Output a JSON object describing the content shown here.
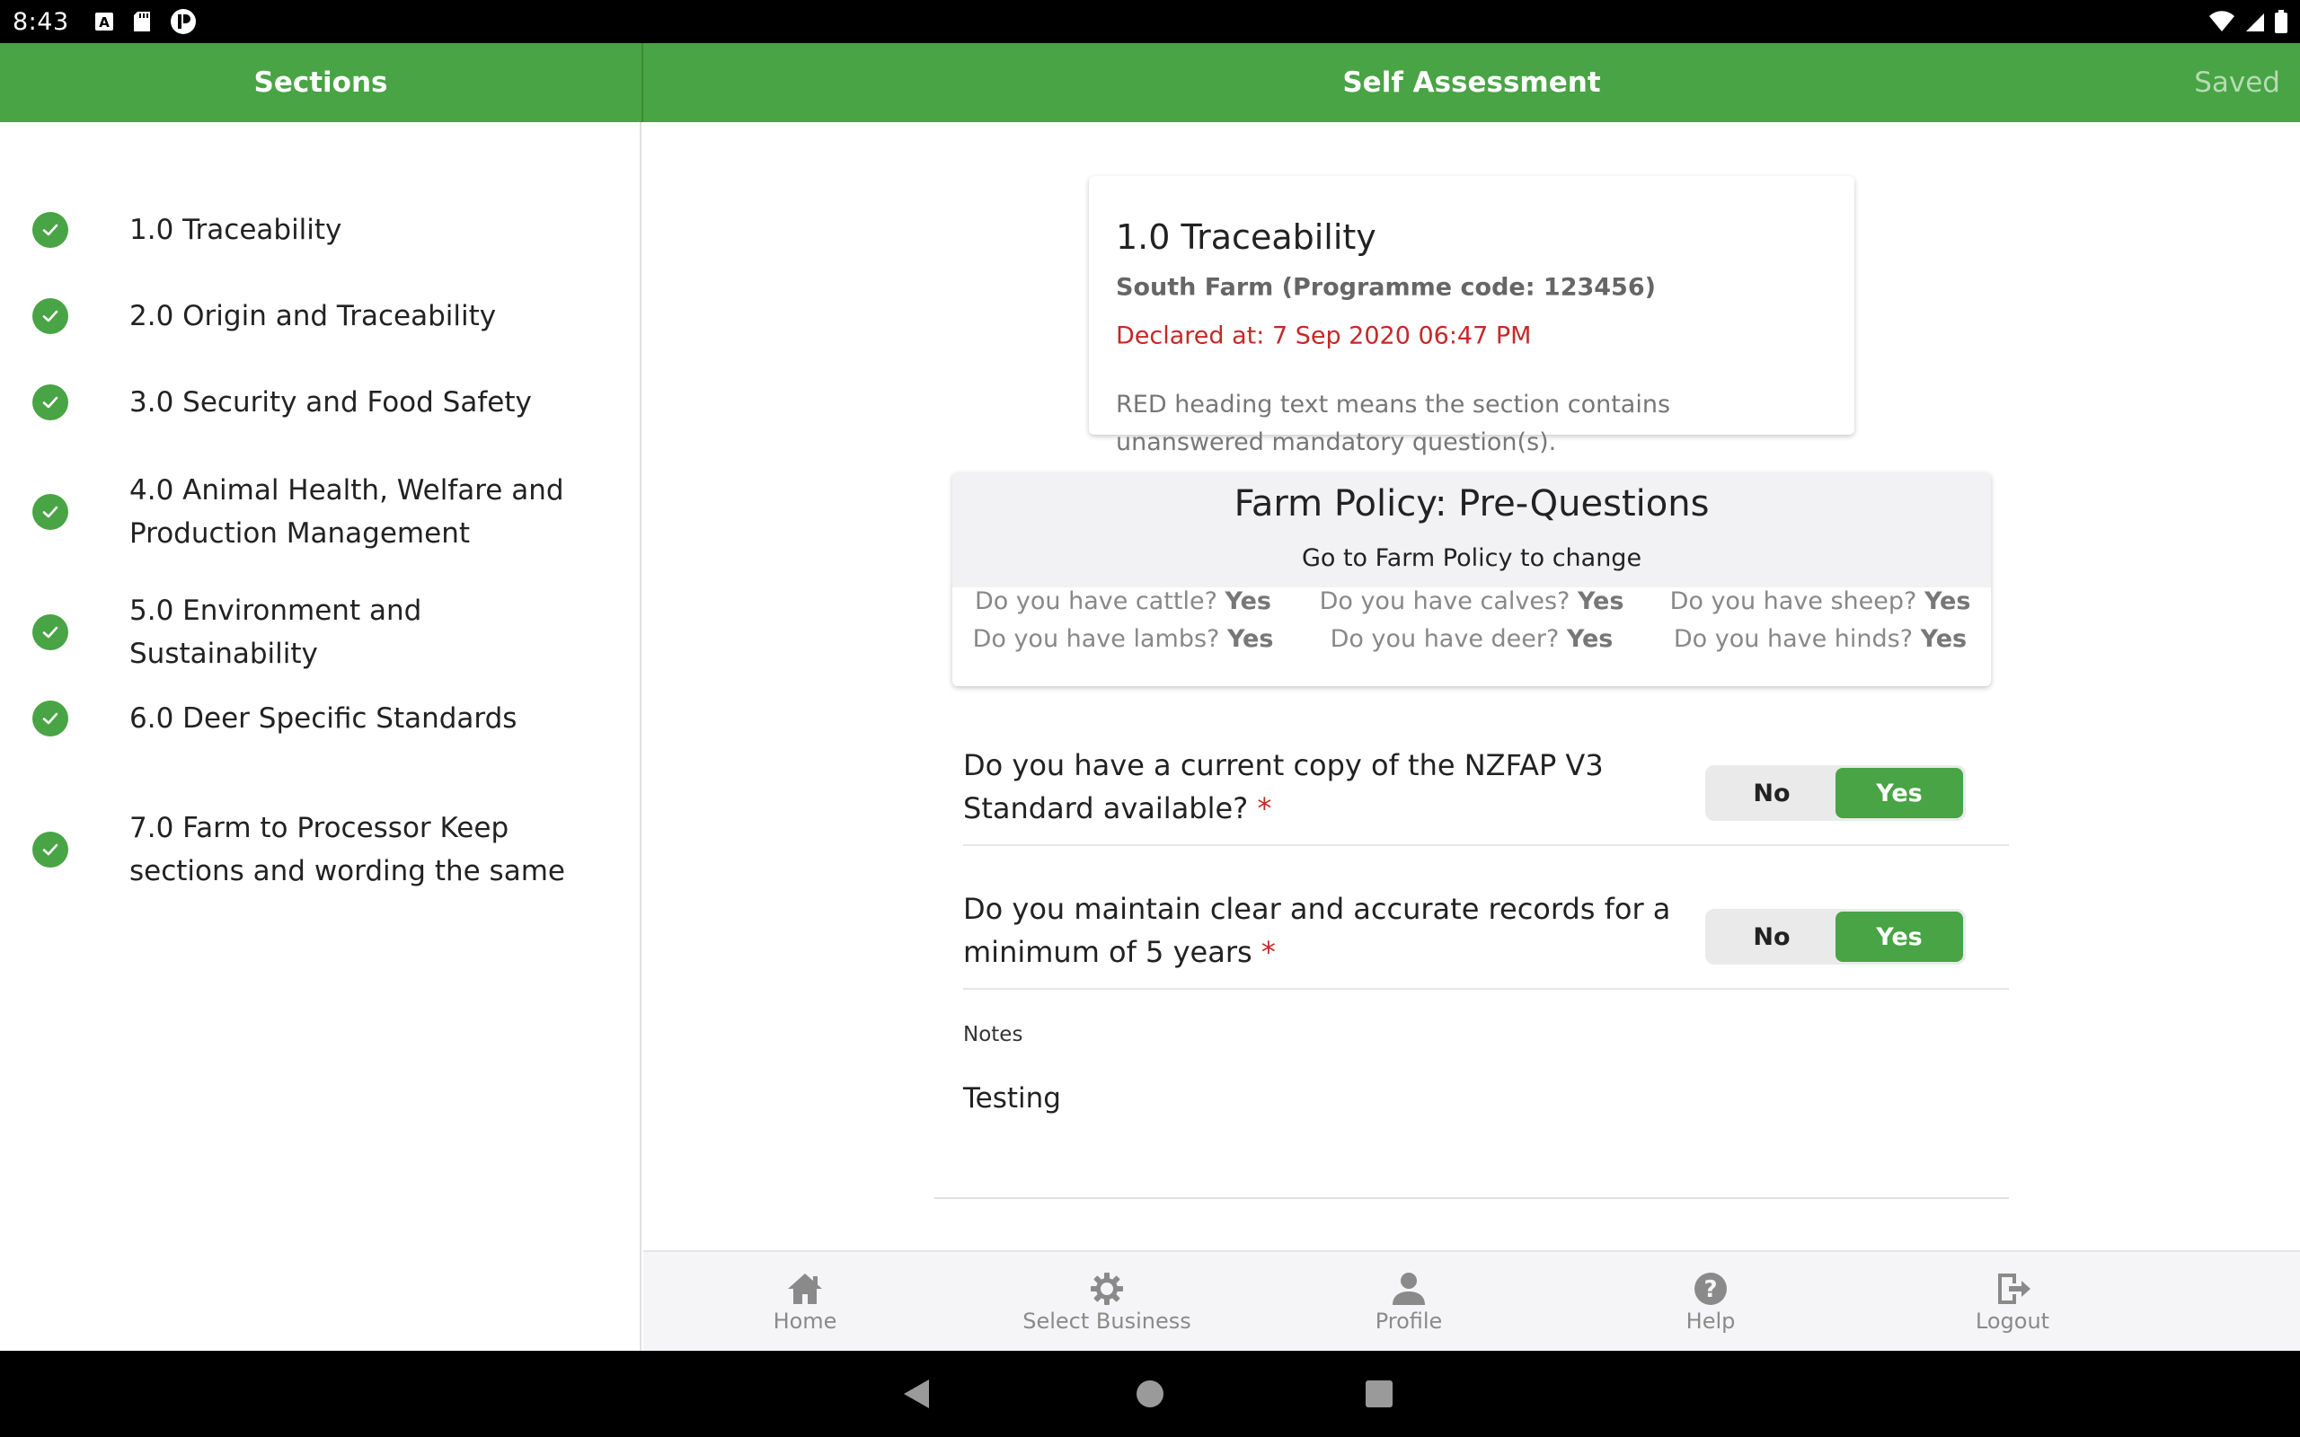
{
  "status_bar": {
    "time": "8:43",
    "left_icons": [
      "keyboard-a-icon",
      "sd-card-icon",
      "app-notification-icon"
    ],
    "right_icons": [
      "wifi-icon",
      "cell-signal-icon",
      "battery-icon"
    ]
  },
  "sidebar": {
    "title": "Sections",
    "items": [
      {
        "label": "1.0 Traceability",
        "status_icon": "check-circle-icon"
      },
      {
        "label": "2.0 Origin and Traceability",
        "status_icon": "check-circle-icon"
      },
      {
        "label": "3.0 Security and Food Safety",
        "status_icon": "check-circle-icon"
      },
      {
        "label": "4.0 Animal Health, Welfare and Production Management",
        "status_icon": "check-circle-icon"
      },
      {
        "label": "5.0 Environment and Sustainability",
        "status_icon": "check-circle-icon"
      },
      {
        "label": "6.0 Deer Specific Standards",
        "status_icon": "check-circle-icon"
      },
      {
        "label": "7.0 Farm to Processor Keep sections and wording the same",
        "status_icon": "check-circle-icon"
      }
    ]
  },
  "header": {
    "title": "Self Assessment",
    "saved_label": "Saved"
  },
  "info_card": {
    "title": "1.0 Traceability",
    "subtitle": "South Farm (Programme code: 123456)",
    "declared": "Declared at: 7 Sep 2020 06:47 PM",
    "note": "RED heading text means the section contains unanswered mandatory question(s)."
  },
  "policy": {
    "title": "Farm Policy: Pre-Questions",
    "subtitle": "Go to Farm Policy to change",
    "questions": [
      {
        "q": "Do you have cattle?",
        "a": "Yes"
      },
      {
        "q": "Do you have calves?",
        "a": "Yes"
      },
      {
        "q": "Do you have sheep?",
        "a": "Yes"
      },
      {
        "q": "Do you have lambs?",
        "a": "Yes"
      },
      {
        "q": "Do you have deer?",
        "a": "Yes"
      },
      {
        "q": "Do you have hinds?",
        "a": "Yes"
      }
    ]
  },
  "questions": [
    {
      "text": "Do you have a current copy of the NZFAP V3 Standard available?",
      "required_mark": "*",
      "no_label": "No",
      "yes_label": "Yes",
      "selected": "Yes"
    },
    {
      "text": "Do you maintain clear and accurate records for a minimum of 5 years",
      "required_mark": "*",
      "no_label": "No",
      "yes_label": "Yes",
      "selected": "Yes"
    }
  ],
  "notes": {
    "label": "Notes",
    "value": "Testing"
  },
  "bottom_nav": [
    {
      "label": "Home",
      "icon": "home-icon"
    },
    {
      "label": "Select Business",
      "icon": "gear-icon"
    },
    {
      "label": "Profile",
      "icon": "person-icon"
    },
    {
      "label": "Help",
      "icon": "help-icon"
    },
    {
      "label": "Logout",
      "icon": "logout-icon"
    }
  ],
  "colors": {
    "primary": "#48a444",
    "required": "#c62828",
    "muted": "#888888"
  }
}
